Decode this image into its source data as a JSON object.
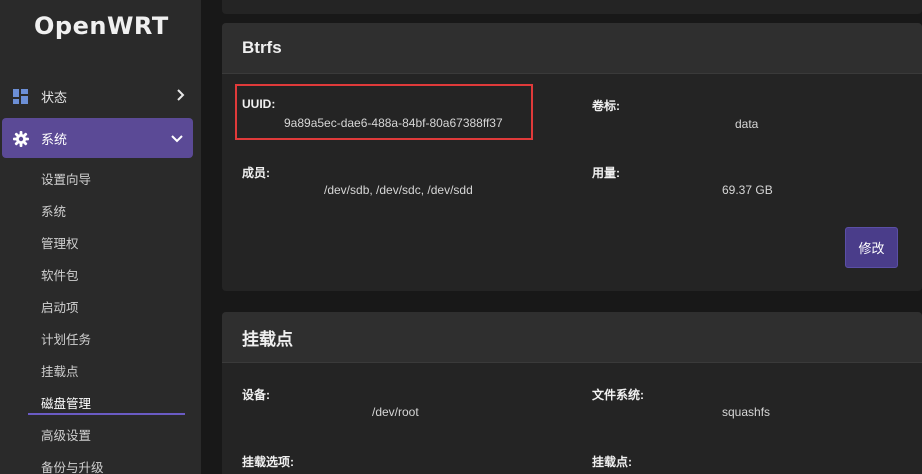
{
  "brand": "OpenWRT",
  "sidebar": {
    "status_label": "状态",
    "system_label": "系统",
    "sub_items": [
      "设置向导",
      "系统",
      "管理权",
      "软件包",
      "启动项",
      "计划任务",
      "挂载点",
      "磁盘管理",
      "高级设置",
      "备份与升级"
    ],
    "active_index": 7
  },
  "btrfs": {
    "title": "Btrfs",
    "uuid_label": "UUID:",
    "uuid_value": "9a89a5ec-dae6-488a-84bf-80a67388ff37",
    "volume_label": "卷标:",
    "volume_value": "data",
    "members_label": "成员:",
    "members_value": "/dev/sdb, /dev/sdc, /dev/sdd",
    "usage_label": "用量:",
    "usage_value": "69.37 GB",
    "modify_button": "修改"
  },
  "mount": {
    "title": "挂载点",
    "device_label": "设备:",
    "device_value": "/dev/root",
    "fs_label": "文件系统:",
    "fs_value": "squashfs",
    "options_label": "挂载选项:",
    "mountpoint_label": "挂载点:"
  },
  "colors": {
    "accent": "#5b4a96",
    "highlight_border": "#e03a3a",
    "button": "#4a3d8a"
  }
}
